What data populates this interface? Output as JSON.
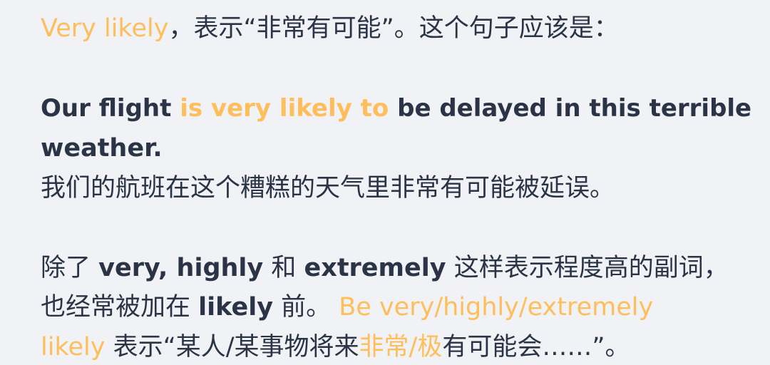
{
  "line1": {
    "highlight": "Very likely",
    "rest": "，表示“非常有可能”。这个句子应该是："
  },
  "example": {
    "part1": "Our flight ",
    "highlight": "is very likely to",
    "part2": " be delayed in this terrible",
    "part3": "weather.",
    "translation": "我们的航班在这个糟糕的天气里非常有可能被延误。"
  },
  "note": {
    "p1": "除了 ",
    "w1": "very, highly",
    "p2": " 和 ",
    "w2": "extremely",
    "p3": " 这样表示程度高的副词，",
    "p4": "也经常被加在 ",
    "w3": "likely",
    "p5": " 前。 ",
    "hl1": "Be very/highly/extremely",
    "hl2": "likely",
    "p6": " 表示“某人/某事物将来",
    "hl3": "非常/极",
    "p7": "有可能会……”。"
  },
  "colors": {
    "text": "#2b3447",
    "highlight": "#ffbe5c",
    "background": "#f0f2f5"
  }
}
